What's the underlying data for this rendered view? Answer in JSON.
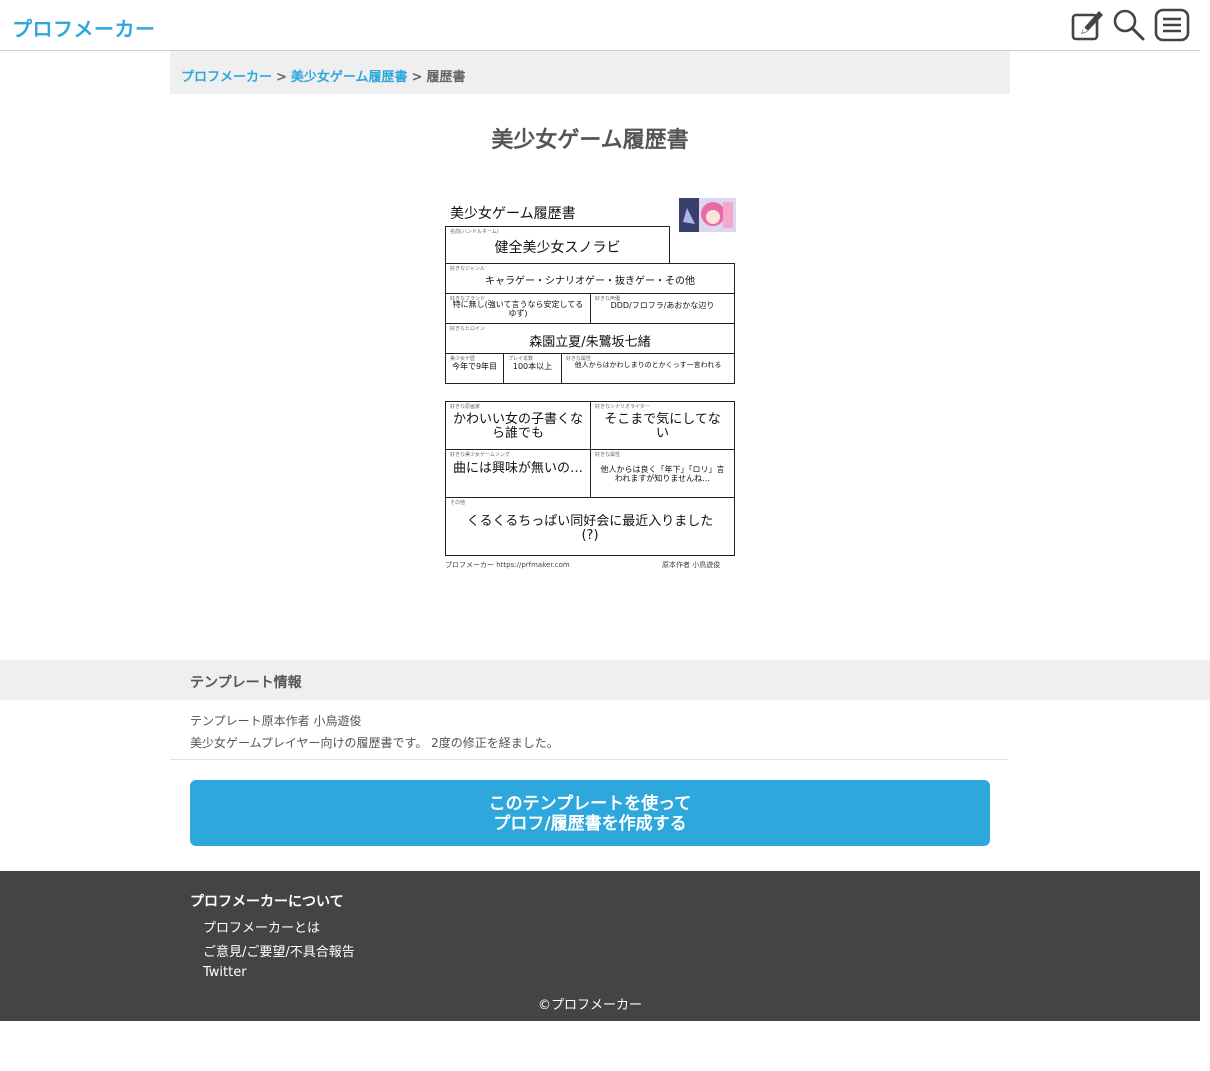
{
  "header": {
    "logo": "プロフメーカー"
  },
  "breadcrumb": {
    "home": "プロフメーカー",
    "sep1": ">",
    "category": "美少女ゲーム履歴書",
    "sep2": ">",
    "current": "履歴書"
  },
  "title": "美少女ゲーム履歴書",
  "sheet": {
    "title": "美少女ゲーム履歴書",
    "name_label": "名前(ハンドルネーム)",
    "name": "健全美少女スノラビ",
    "genre_label": "好きなジャンル",
    "genre": "キャラゲー・シナリオゲー・抜きゲー・その他",
    "brand_label": "好きなブランド",
    "brand": "特に無し(強いて言うなら安定してるゆず)",
    "seiyuu_label": "好きな声優",
    "seiyuu": "DDD/フロフラ/あおかな辺り",
    "heroine_label": "好きなヒロイン",
    "heroine": "森園立夏/朱鷺坂七緒",
    "history_label": "美少女ゲ歴",
    "history": "今年で9年目",
    "count_label": "プレイ本数",
    "count": "100本以上",
    "habit_label": "好きな属性",
    "habit": "他人からはかわしまりのとかくっす一言われる",
    "artist_label": "好きな原画家",
    "artist": "かわいい女の子書くなら誰でも",
    "writer_label": "好きなシナリオライター",
    "writer": "そこまで気にしてない",
    "song_label": "好きな美少女ゲームソング",
    "song": "曲には興味が無いの…",
    "attr_label": "好きな属性",
    "attr": "他人からは良く「年下」「ロリ」言われますが知りませんね…",
    "other_label": "その他",
    "other": "くるくるちっぱい同好会に最近入りました(?)",
    "foot_left": "プロフメーカー https://prfmaker.com",
    "foot_right": "原本作者 小鳥遊俊"
  },
  "info": {
    "title": "テンプレート情報",
    "author": "テンプレート原本作者 小鳥遊俊",
    "desc": "美少女ゲームプレイヤー向けの履歴書です。 2度の修正を経ました。"
  },
  "cta": {
    "line1": "このテンプレートを使って",
    "line2": "プロフ/履歴書を作成する"
  },
  "footer": {
    "heading": "プロフメーカーについて",
    "links": [
      "プロフメーカーとは",
      "ご意見/ご要望/不具合報告",
      "Twitter"
    ],
    "copyright": "©プロフメーカー"
  },
  "colors": {
    "accent": "#2ea8dc",
    "footer_bg": "#444444"
  },
  "icons": [
    "edit-icon",
    "search-icon",
    "menu-icon"
  ]
}
